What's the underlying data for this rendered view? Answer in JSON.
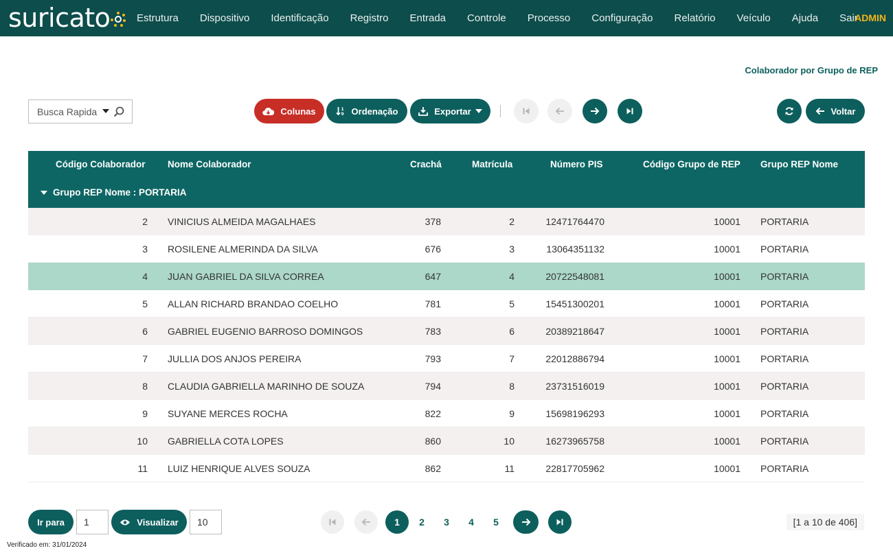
{
  "app": {
    "logo_text": "suricato",
    "nav_items": [
      "Estrutura",
      "Dispositivo",
      "Identificação",
      "Registro",
      "Entrada",
      "Controle",
      "Processo",
      "Configuração",
      "Relatório",
      "Veículo",
      "Ajuda",
      "Sair"
    ],
    "user": "ADMIN"
  },
  "page": {
    "title": "Colaborador por Grupo de REP"
  },
  "toolbar": {
    "search_placeholder": "Busca Rapida",
    "columns_label": "Colunas",
    "sort_label": "Ordenação",
    "export_label": "Exportar",
    "back_label": "Voltar"
  },
  "table": {
    "headers": [
      "Código Colaborador",
      "Nome Colaborador",
      "Crachá",
      "Matrícula",
      "Número PIS",
      "Código Grupo de REP",
      "Grupo REP Nome"
    ],
    "group_label": "Grupo REP Nome : PORTARIA",
    "selected_row_index": 2,
    "rows": [
      [
        "2",
        "VINICIUS ALMEIDA MAGALHAES",
        "378",
        "2",
        "12471764470",
        "10001",
        "PORTARIA"
      ],
      [
        "3",
        "ROSILENE ALMERINDA DA SILVA",
        "676",
        "3",
        "13064351132",
        "10001",
        "PORTARIA"
      ],
      [
        "4",
        "JUAN GABRIEL DA SILVA CORREA",
        "647",
        "4",
        "20722548081",
        "10001",
        "PORTARIA"
      ],
      [
        "5",
        "ALLAN RICHARD BRANDAO COELHO",
        "781",
        "5",
        "15451300201",
        "10001",
        "PORTARIA"
      ],
      [
        "6",
        "GABRIEL EUGENIO BARROSO DOMINGOS",
        "783",
        "6",
        "20389218647",
        "10001",
        "PORTARIA"
      ],
      [
        "7",
        "JULLIA DOS ANJOS PEREIRA",
        "793",
        "7",
        "22012886794",
        "10001",
        "PORTARIA"
      ],
      [
        "8",
        "CLAUDIA GABRIELLA MARINHO DE SOUZA",
        "794",
        "8",
        "23731516019",
        "10001",
        "PORTARIA"
      ],
      [
        "9",
        "SUYANE MERCES ROCHA",
        "822",
        "9",
        "15698196293",
        "10001",
        "PORTARIA"
      ],
      [
        "10",
        "GABRIELLA COTA LOPES",
        "860",
        "10",
        "16273965758",
        "10001",
        "PORTARIA"
      ],
      [
        "11",
        "LUIZ HENRIQUE ALVES SOUZA",
        "862",
        "11",
        "22817705962",
        "10001",
        "PORTARIA"
      ]
    ]
  },
  "footer": {
    "goto_label": "Ir para",
    "goto_value": "1",
    "view_label": "Visualizar",
    "view_value": "10",
    "pages": [
      "1",
      "2",
      "3",
      "4",
      "5"
    ],
    "current_page": "1",
    "range_text": "[1 a 10 de 406]",
    "verified_text": "Verificado em: 31/01/2024"
  },
  "colors": {
    "brand": "#0d4d4b",
    "primary": "#0d5f5d",
    "header_bg": "#0d6664",
    "danger": "#c72e26",
    "accent": "#f3b51b",
    "row_selected": "#acd8c9"
  }
}
